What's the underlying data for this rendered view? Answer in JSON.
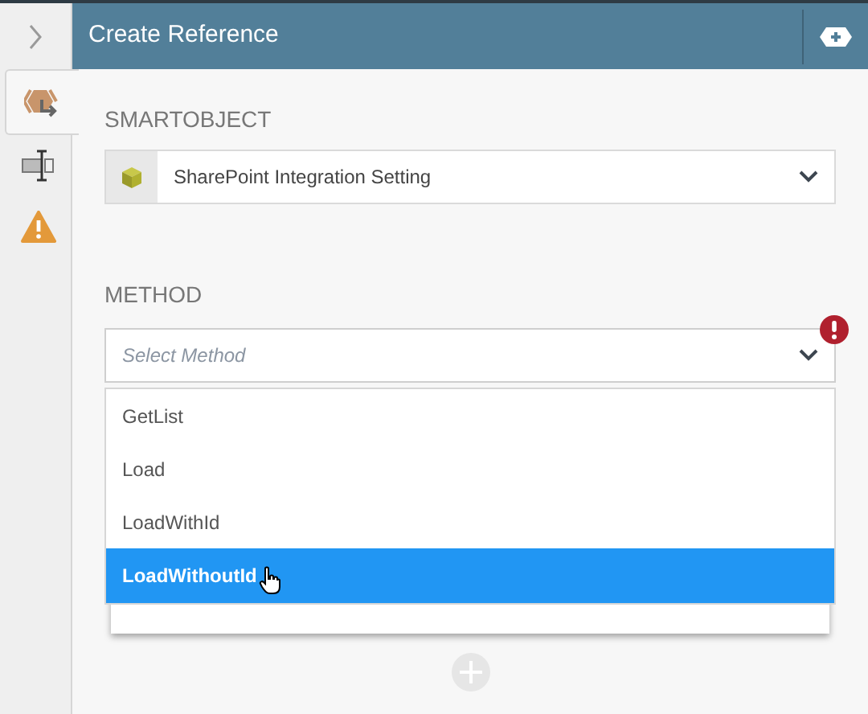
{
  "header": {
    "title": "Create Reference"
  },
  "rail_tabs": [
    {
      "kind": "smartobject",
      "selected": true
    },
    {
      "kind": "control",
      "selected": false
    },
    {
      "kind": "warning",
      "selected": false
    }
  ],
  "smartobject": {
    "label": "SMARTOBJECT",
    "value": "SharePoint Integration Setting"
  },
  "method": {
    "label": "METHOD",
    "placeholder": "Select Method",
    "error": true,
    "options": [
      {
        "label": "GetList",
        "selected": false
      },
      {
        "label": "Load",
        "selected": false
      },
      {
        "label": "LoadWithId",
        "selected": false
      },
      {
        "label": "LoadWithoutId",
        "selected": true
      }
    ]
  }
}
